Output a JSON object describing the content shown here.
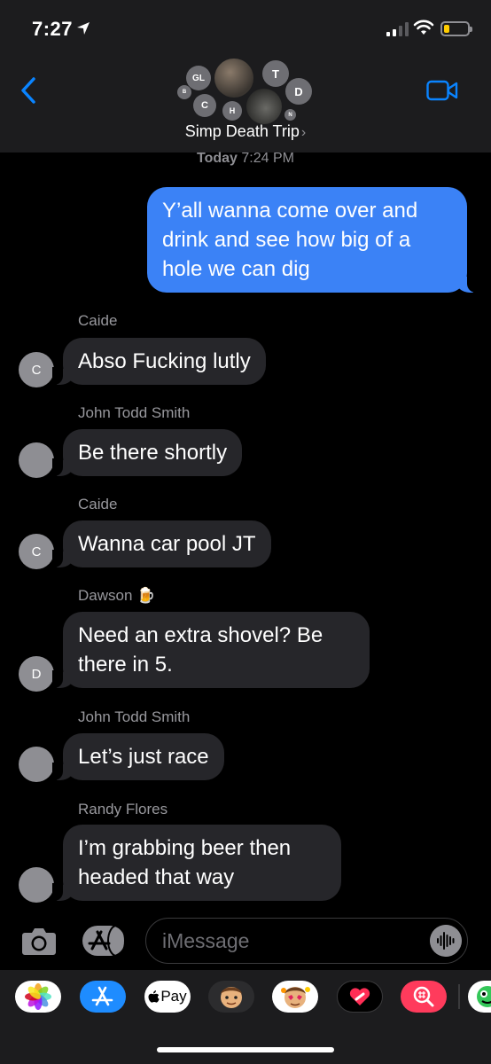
{
  "status_bar": {
    "time": "7:27"
  },
  "header": {
    "group_name": "Simp Death Trip",
    "chevron": "›",
    "avatars": {
      "gl": "GL",
      "t": "T",
      "c": "C",
      "h": "H",
      "d": "D",
      "n": "N",
      "b": "B"
    }
  },
  "timestamp": {
    "day": "Today",
    "time": "7:24 PM"
  },
  "messages": [
    {
      "sender": "",
      "text": "Y’all wanna come over and drink and see how big of a hole we can dig",
      "outgoing": true
    },
    {
      "sender": "Caide",
      "text": "Abso Fucking lutly",
      "avatar": "C"
    },
    {
      "sender": "John Todd Smith",
      "text": "Be there shortly",
      "avatar": ""
    },
    {
      "sender": "Caide",
      "text": "Wanna car pool JT",
      "avatar": "C"
    },
    {
      "sender": "Dawson 🍺",
      "text": "Need an extra shovel? Be there in 5.",
      "avatar": "D"
    },
    {
      "sender": "John Todd Smith",
      "text": "Let’s just race",
      "avatar": ""
    },
    {
      "sender": "Randy Flores",
      "text": "I’m grabbing beer then headed that way",
      "avatar": ""
    }
  ],
  "input": {
    "placeholder": "iMessage"
  },
  "app_drawer": {
    "items": [
      "photos-app",
      "app-store-app",
      "apple-pay-app",
      "memoji-app",
      "memoji-stickers-app",
      "digital-touch-app",
      "search-images-app",
      "more-app"
    ],
    "apple_pay_label": "Pay"
  },
  "colors": {
    "accent": "#0a84ff",
    "outgoing_bubble": "#3b82f6",
    "incoming_bubble": "#26262a",
    "background": "#000000"
  }
}
